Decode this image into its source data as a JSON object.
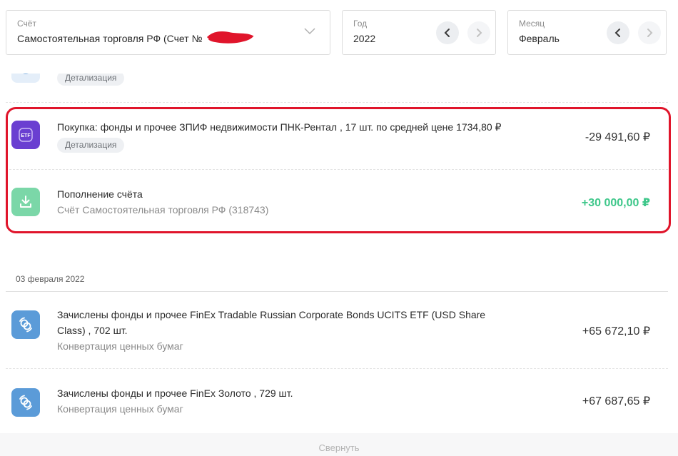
{
  "filters": {
    "account": {
      "label": "Счёт",
      "value": "Самостоятельная торговля РФ (Счет №"
    },
    "year": {
      "label": "Год",
      "value": "2022"
    },
    "month": {
      "label": "Месяц",
      "value": "Февраль"
    }
  },
  "operations_top": [
    {
      "title": "",
      "chip": "Детализация",
      "amount": "",
      "icon": "conversion-icon"
    },
    {
      "title": "Покупка: фонды и прочее ЗПИФ недвижимости ПНК-Рентал , 17 шт. по средней цене 1734,80 ₽",
      "chip": "Детализация",
      "amount": "-29 491,60 ₽",
      "icon": "etf-icon",
      "icon_label": "ETF"
    },
    {
      "title": "Пополнение счёта",
      "subtitle": "Счёт Самостоятельная торговля РФ (318743)",
      "amount": "+30 000,00 ₽",
      "icon": "download-icon"
    }
  ],
  "date_group": {
    "date": "03 февраля 2022",
    "operations": [
      {
        "title_line1": "Зачислены фонды и прочее FinEx Tradable Russian Corporate Bonds UCITS ETF (USD Share",
        "title_line2": "Class) , 702 шт.",
        "subtitle": "Конвертация ценных бумаг",
        "amount": "+65 672,10 ₽",
        "icon": "conversion-icon"
      },
      {
        "title": "Зачислены фонды и прочее FinEx Золото , 729 шт.",
        "subtitle": "Конвертация ценных бумаг",
        "amount": "+67 687,65 ₽",
        "icon": "conversion-icon"
      }
    ]
  },
  "collapse_label": "Свернуть",
  "colors": {
    "highlight": "#e0152b",
    "etf_icon": "#6a3fd1",
    "deposit_icon": "#7bd7a8",
    "conversion_icon": "#5b9bd8",
    "positive_amount": "#3ec78a"
  }
}
